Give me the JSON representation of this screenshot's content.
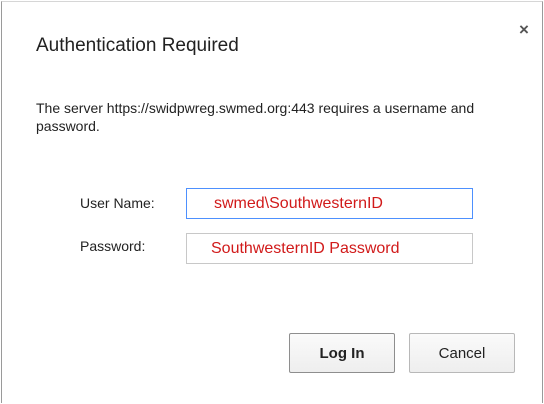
{
  "dialog": {
    "title": "Authentication Required",
    "close_glyph": "×",
    "message": "The server https://swidpwreg.swmed.org:443 requires a username and password."
  },
  "form": {
    "username_label": "User Name:",
    "username_value": "swmed\\SouthwesternID",
    "password_label": "Password:",
    "password_value": "SouthwesternID Password"
  },
  "buttons": {
    "login_label": "Log In",
    "cancel_label": "Cancel"
  },
  "colors": {
    "hint_text": "#d11a1a",
    "focus_border": "#4d90fe"
  },
  "icons": {
    "close": "close-icon"
  }
}
